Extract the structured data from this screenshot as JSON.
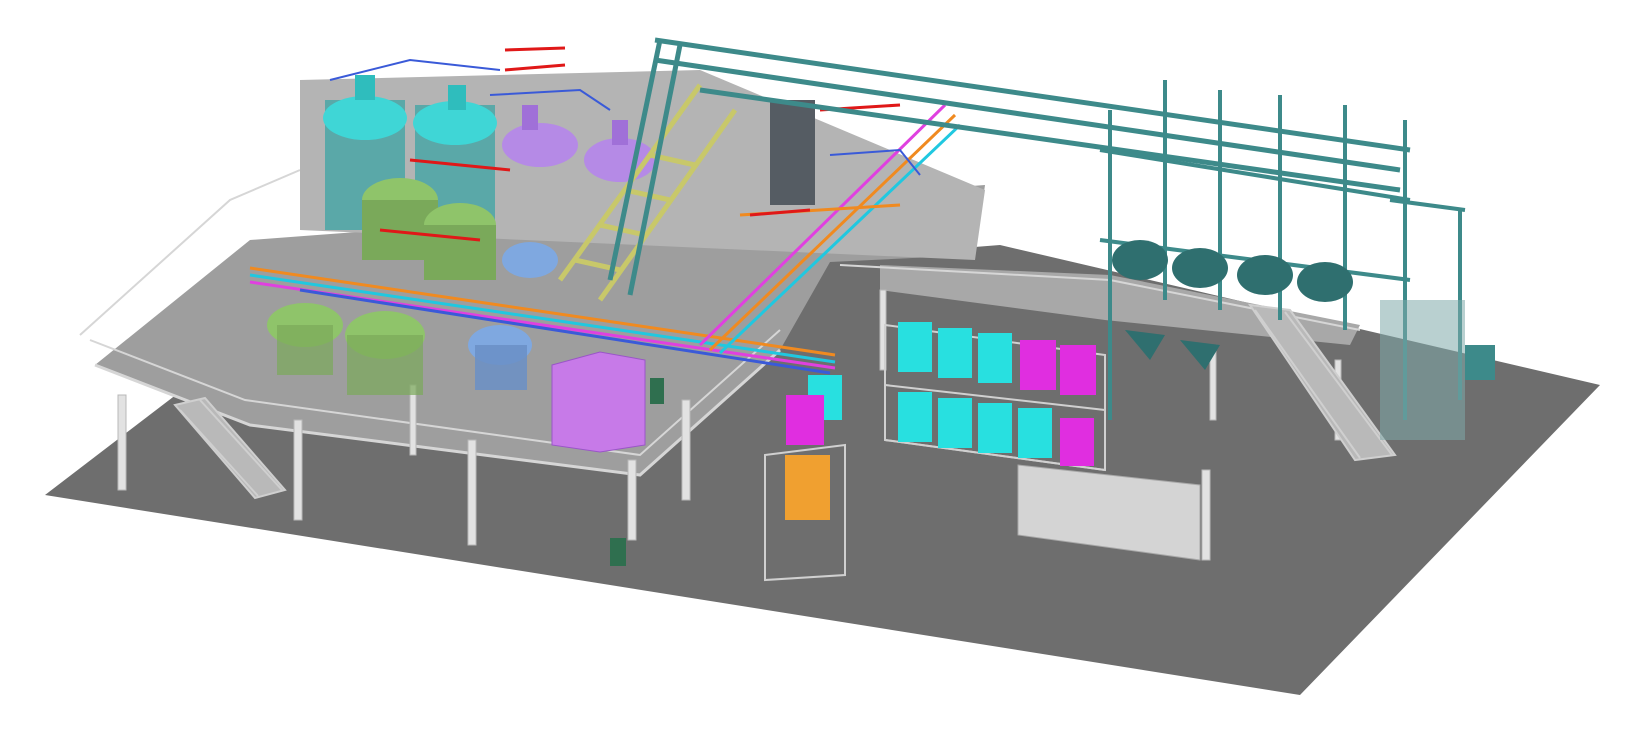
{
  "scene": {
    "colors": {
      "background": "#ffffff",
      "floor": "#6e6e6e",
      "mezzanine": "#9a9a9a",
      "steel": "#d8d8d8",
      "handrail": "#c8c8c8",
      "reactor_cyan": "#3fd6d6",
      "reactor_green": "#8fc46a",
      "reactor_violet": "#b58ae6",
      "reactor_blue": "#7fa8e0",
      "bin_magenta": "#e02ee0",
      "bin_cyan": "#28e0e0",
      "bin_orange": "#f0a030",
      "silo_frame": "#3d8a8a",
      "silo_dark": "#2f6f6f",
      "pipe_red": "#e01818",
      "pipe_orange": "#f08a20",
      "pipe_yellow": "#c8c86a",
      "pipe_blue": "#3a5ad8",
      "pipe_pink": "#e040e0",
      "pipe_cyan": "#20c8e0",
      "wall_panel": "#d4d4d4"
    },
    "equipment": [
      {
        "kind": "cyan-reactor",
        "count": 2
      },
      {
        "kind": "violet-reactor",
        "count": 2
      },
      {
        "kind": "green-reactor",
        "count": 4
      },
      {
        "kind": "blue-reactor",
        "count": 2
      },
      {
        "kind": "cyan-ibc-bin",
        "count": 8
      },
      {
        "kind": "magenta-ibc-bin",
        "count": 4
      },
      {
        "kind": "orange-tank",
        "count": 1
      },
      {
        "kind": "silo-hopper",
        "count": 4
      }
    ]
  }
}
